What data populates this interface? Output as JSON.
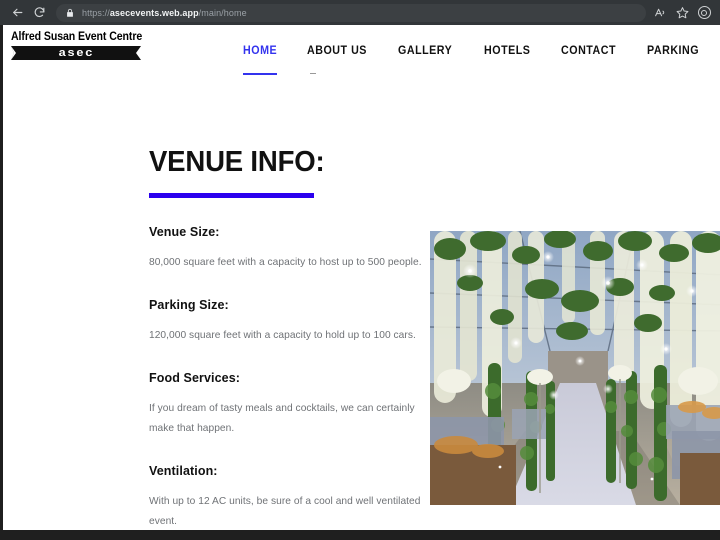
{
  "browser": {
    "back_icon": "back-arrow-icon",
    "reload_icon": "reload-icon",
    "lock_icon": "lock-icon",
    "url_scheme": "https://",
    "url_domain": "asecevents.web.app",
    "url_path": "/main/home",
    "read_aloud_icon": "read-aloud-icon",
    "favorite_icon": "star-icon",
    "profile_icon": "profile-icon"
  },
  "site": {
    "logo": {
      "title": "Alfred Susan Event Centre",
      "mark": "asec"
    },
    "nav": [
      {
        "label": "HOME",
        "active": true
      },
      {
        "label": "ABOUT US",
        "active": false
      },
      {
        "label": "GALLERY",
        "active": false
      },
      {
        "label": "HOTELS",
        "active": false
      },
      {
        "label": "CONTACT",
        "active": false
      },
      {
        "label": "PARKING",
        "active": false
      }
    ]
  },
  "main": {
    "title": "VENUE INFO:",
    "accent_color": "#2b00ee",
    "blocks": [
      {
        "heading": "Venue Size:",
        "text": "80,000 square feet with a capacity to host up to 500 people."
      },
      {
        "heading": "Parking Size:",
        "text": "120,000 square feet with a capacity to hold up to 100 cars."
      },
      {
        "heading": "Food Services:",
        "text": "If you dream of tasty meals and cocktails, we can certainly make that happen."
      },
      {
        "heading": "Ventilation:",
        "text": "With up to 12 AC units, be sure of a cool and well ventilated event."
      }
    ],
    "photo": {
      "alt": "Decorated event hall with hanging greenery, white floral garlands and a white aisle runner"
    }
  }
}
